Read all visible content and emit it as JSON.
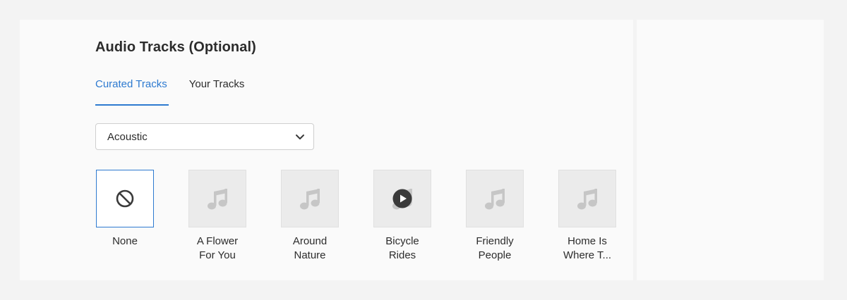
{
  "section": {
    "title": "Audio Tracks (Optional)"
  },
  "tabs": [
    {
      "label": "Curated Tracks",
      "active": true
    },
    {
      "label": "Your Tracks",
      "active": false
    }
  ],
  "genre_select": {
    "value": "Acoustic",
    "icon": "chevron-down-icon"
  },
  "tracks": [
    {
      "line1": "None",
      "line2": "",
      "icon": "no-symbol-icon",
      "selected": true
    },
    {
      "line1": "A Flower",
      "line2": "For You",
      "icon": "music-note-icon",
      "selected": false
    },
    {
      "line1": "Around",
      "line2": "Nature",
      "icon": "music-note-icon",
      "selected": false
    },
    {
      "line1": "Bicycle",
      "line2": "Rides",
      "icon": "music-note-icon",
      "playing": true,
      "selected": false
    },
    {
      "line1": "Friendly",
      "line2": "People",
      "icon": "music-note-icon",
      "selected": false
    },
    {
      "line1": "Home Is",
      "line2": "Where T...",
      "icon": "music-note-icon",
      "selected": false
    }
  ],
  "colors": {
    "accent": "#2d7ad0",
    "thumb_bg": "#ebebeb",
    "icon_gray": "#c6c6c6",
    "play_button": "#3a3a3a"
  }
}
